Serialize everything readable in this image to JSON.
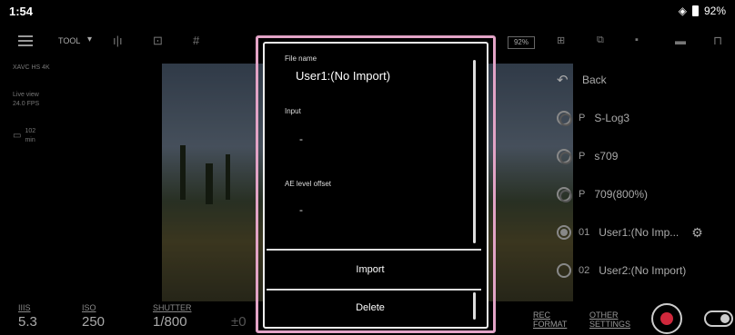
{
  "status": {
    "time": "1:54",
    "battery": "92%"
  },
  "toolbar": {
    "tool_label": "TOOL",
    "glyph_a": "ı|ı",
    "glyph_b": "⊡",
    "glyph_c": "#",
    "percent": "92%",
    "icons": [
      "menu-icon",
      "waveform-icon",
      "frame-icon",
      "grid-icon",
      "eye-icon",
      "lock-icon"
    ]
  },
  "left_info": {
    "codec": "XAVC HS 4K",
    "live_view": "Live view",
    "fps": "24.0 FPS",
    "remaining": "102",
    "remaining_unit": "min"
  },
  "bottom": {
    "iris": {
      "label": "IIIS",
      "value": "5.3"
    },
    "iso": {
      "label": "ISO",
      "value": "250"
    },
    "shutter": {
      "label": "SHUTTER",
      "value": "1/800"
    },
    "ev": {
      "value": "±0"
    },
    "rec_format": {
      "line1": "REC",
      "line2": "FORMAT"
    },
    "other_settings": {
      "line1": "OTHER",
      "line2": "SETTINGS"
    }
  },
  "side_list": {
    "back": "Back",
    "items": [
      {
        "prefix": "P",
        "label": "S-Log3"
      },
      {
        "prefix": "P",
        "label": "s709"
      },
      {
        "prefix": "P",
        "label": "709(800%)"
      },
      {
        "prefix": "01",
        "label": "User1:(No Imp..."
      },
      {
        "prefix": "02",
        "label": "User2:(No Import)"
      }
    ]
  },
  "dialog": {
    "file_name_label": "File name",
    "file_name_value": "User1:(No Import)",
    "input_label": "Input",
    "input_value": "-",
    "ae_label": "AE level offset",
    "ae_value": "-",
    "import_button": "Import",
    "delete_button": "Delete"
  }
}
